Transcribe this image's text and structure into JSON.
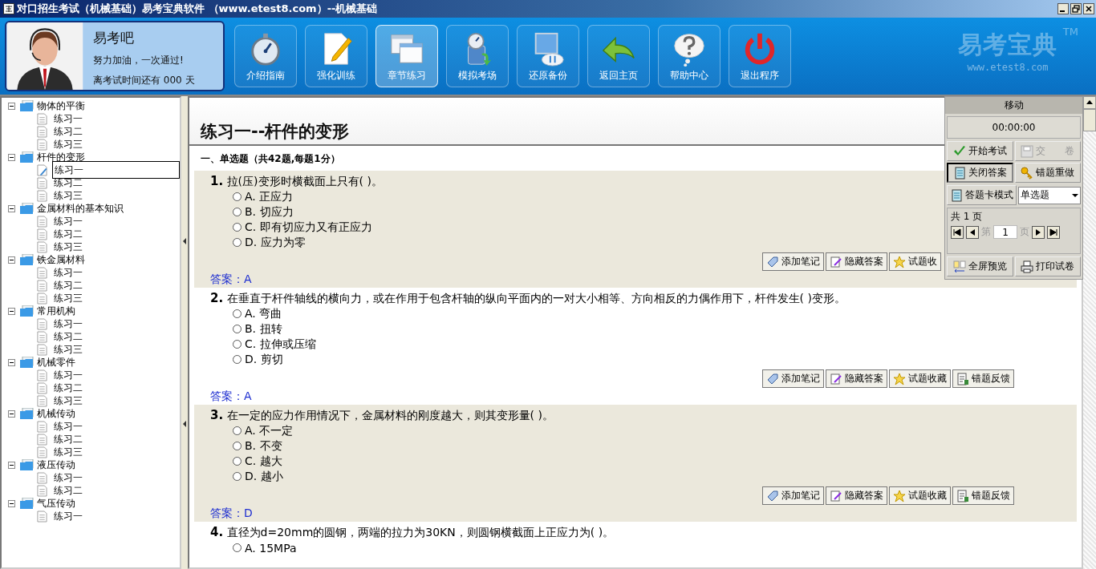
{
  "window": {
    "title": "对口招生考试（机械基础）易考宝典软件 （www.etest8.com）--机械基础"
  },
  "profile": {
    "name": "易考吧",
    "slogan": "努力加油，一次通过!",
    "countdown": "离考试时间还有 000 天"
  },
  "toolbar": [
    {
      "label": "介绍指南",
      "kind": "stopwatch",
      "selected": false
    },
    {
      "label": "强化训练",
      "kind": "notepad",
      "selected": false
    },
    {
      "label": "章节练习",
      "kind": "windows",
      "selected": true
    },
    {
      "label": "模拟考场",
      "kind": "globe",
      "selected": false
    },
    {
      "label": "还原备份",
      "kind": "backup",
      "selected": false
    },
    {
      "label": "返回主页",
      "kind": "back",
      "selected": false
    },
    {
      "label": "帮助中心",
      "kind": "help",
      "selected": false
    },
    {
      "label": "退出程序",
      "kind": "power",
      "selected": false
    }
  ],
  "brand": {
    "logo": "易考宝典",
    "tm": "TM",
    "url": "www.etest8.com"
  },
  "tree": [
    {
      "label": "物体的平衡",
      "expanded": true,
      "children": [
        {
          "label": "练习一",
          "selected": false
        },
        {
          "label": "练习二",
          "selected": false
        },
        {
          "label": "练习三",
          "selected": false
        }
      ]
    },
    {
      "label": "杆件的变形",
      "expanded": true,
      "children": [
        {
          "label": "练习一",
          "selected": true
        },
        {
          "label": "练习二",
          "selected": false
        },
        {
          "label": "练习三",
          "selected": false
        }
      ]
    },
    {
      "label": "金属材料的基本知识",
      "expanded": true,
      "children": [
        {
          "label": "练习一",
          "selected": false
        },
        {
          "label": "练习二",
          "selected": false
        },
        {
          "label": "练习三",
          "selected": false
        }
      ]
    },
    {
      "label": "铁金属材料",
      "expanded": true,
      "children": [
        {
          "label": "练习一",
          "selected": false
        },
        {
          "label": "练习二",
          "selected": false
        },
        {
          "label": "练习三",
          "selected": false
        }
      ]
    },
    {
      "label": "常用机构",
      "expanded": true,
      "children": [
        {
          "label": "练习一",
          "selected": false
        },
        {
          "label": "练习二",
          "selected": false
        },
        {
          "label": "练习三",
          "selected": false
        }
      ]
    },
    {
      "label": "机械零件",
      "expanded": true,
      "children": [
        {
          "label": "练习一",
          "selected": false
        },
        {
          "label": "练习二",
          "selected": false
        },
        {
          "label": "练习三",
          "selected": false
        }
      ]
    },
    {
      "label": "机械传动",
      "expanded": true,
      "children": [
        {
          "label": "练习一",
          "selected": false
        },
        {
          "label": "练习二",
          "selected": false
        },
        {
          "label": "练习三",
          "selected": false
        }
      ]
    },
    {
      "label": "液压传动",
      "expanded": true,
      "children": [
        {
          "label": "练习一",
          "selected": false
        },
        {
          "label": "练习二",
          "selected": false
        }
      ]
    },
    {
      "label": "气压传动",
      "expanded": true,
      "children": [
        {
          "label": "练习一",
          "selected": false
        }
      ]
    }
  ],
  "page": {
    "title": "练习一--杆件的变形",
    "section": "一、单选题（共42题,每题1分）",
    "questions": [
      {
        "number": "1.",
        "text": "拉(压)变形时横截面上只有( )。",
        "options": [
          {
            "label": "A. 正应力",
            "selected": false
          },
          {
            "label": "B. 切应力",
            "selected": false
          },
          {
            "label": "C. 即有切应力又有正应力",
            "selected": false
          },
          {
            "label": "D. 应力为零",
            "selected": false
          }
        ],
        "actions": [
          {
            "label": "添加笔记",
            "kind": "note"
          },
          {
            "label": "隐藏答案",
            "kind": "hide"
          },
          {
            "label": "试题收",
            "kind": "star"
          }
        ],
        "answer": "答案：A"
      },
      {
        "number": "2.",
        "text": "在垂直于杆件轴线的横向力，或在作用于包含杆轴的纵向平面内的一对大小相等、方向相反的力偶作用下，杆件发生( )变形。",
        "options": [
          {
            "label": "A. 弯曲",
            "selected": false
          },
          {
            "label": "B. 扭转",
            "selected": false
          },
          {
            "label": "C. 拉伸或压缩",
            "selected": false
          },
          {
            "label": "D. 剪切",
            "selected": false
          }
        ],
        "actions": [
          {
            "label": "添加笔记",
            "kind": "note"
          },
          {
            "label": "隐藏答案",
            "kind": "hide"
          },
          {
            "label": "试题收藏",
            "kind": "star"
          },
          {
            "label": "错题反馈",
            "kind": "feedback"
          }
        ],
        "answer": "答案：A"
      },
      {
        "number": "3.",
        "text": "在一定的应力作用情况下，金属材料的刚度越大，则其变形量( )。",
        "options": [
          {
            "label": "A. 不一定",
            "selected": false
          },
          {
            "label": "B. 不变",
            "selected": false
          },
          {
            "label": "C. 越大",
            "selected": false
          },
          {
            "label": "D. 越小",
            "selected": false
          }
        ],
        "actions": [
          {
            "label": "添加笔记",
            "kind": "note"
          },
          {
            "label": "隐藏答案",
            "kind": "hide"
          },
          {
            "label": "试题收藏",
            "kind": "star"
          },
          {
            "label": "错题反馈",
            "kind": "feedback"
          }
        ],
        "answer": "答案：D"
      },
      {
        "number": "4.",
        "text": "直径为d=20mm的圆钢，两端的拉力为30KN，则圆钢横截面上正应力为( )。",
        "options": [
          {
            "label": "A. 15MPa",
            "selected": false
          }
        ]
      }
    ]
  },
  "panel": {
    "title": "移动",
    "timer": "00:00:00",
    "buttons": [
      {
        "label": "开始考试",
        "kind": "check",
        "disabled": false,
        "selected": false
      },
      {
        "label": "交　　卷",
        "kind": "save",
        "disabled": true,
        "selected": false
      },
      {
        "label": "关闭答案",
        "kind": "card",
        "disabled": false,
        "selected": true
      },
      {
        "label": "错题重做",
        "kind": "key",
        "disabled": false,
        "selected": false
      }
    ],
    "mode_button": "答题卡模式",
    "type_select": "单选题",
    "pages": {
      "label": "共 1 页",
      "prefix": "第",
      "value": "1",
      "suffix": "页"
    },
    "bottom": [
      {
        "label": "全屏预览",
        "kind": "preview"
      },
      {
        "label": "打印试卷",
        "kind": "print"
      }
    ]
  }
}
